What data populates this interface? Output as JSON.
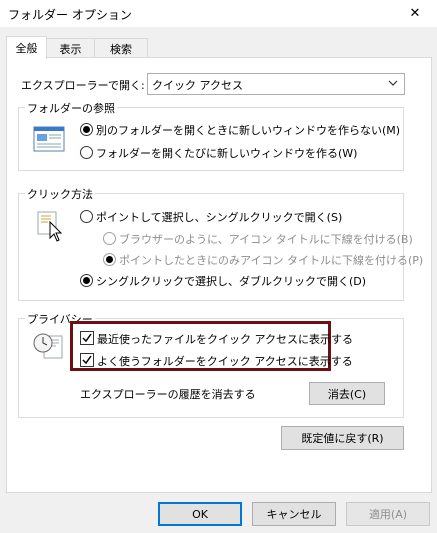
{
  "window": {
    "title": "フォルダー オプション",
    "close_glyph": "✕"
  },
  "tabs": [
    {
      "label": "全般"
    },
    {
      "label": "表示"
    },
    {
      "label": "検索"
    }
  ],
  "general": {
    "open_label": "エクスプローラーで開く:",
    "open_value": "クイック アクセス",
    "browse": {
      "title": "フォルダーの参照",
      "option_same": "別のフォルダーを開くときに新しいウィンドウを作らない(M)",
      "option_new": "フォルダーを開くたびに新しいウィンドウを作る(W)"
    },
    "click": {
      "title": "クリック方法",
      "single": "ポイントして選択し、シングルクリックで開く(S)",
      "underline_browser": "ブラウザーのように、アイコン タイトルに下線を付ける(B)",
      "underline_point": "ポイントしたときにのみアイコン タイトルに下線を付ける(P)",
      "double": "シングルクリックで選択し、ダブルクリックで開く(D)"
    },
    "privacy": {
      "title": "プライバシー",
      "recent_files": "最近使ったファイルをクイック アクセスに表示する",
      "frequent_folders": "よく使うフォルダーをクイック アクセスに表示する",
      "clear_label": "エクスプローラーの履歴を消去する",
      "clear_button": "消去(C)"
    },
    "restore_defaults": "既定値に戻す(R)"
  },
  "footer": {
    "ok": "OK",
    "cancel": "キャンセル",
    "apply": "適用(A)"
  },
  "colors": {
    "highlight": "#6e0f14",
    "accent": "#0078d7"
  }
}
